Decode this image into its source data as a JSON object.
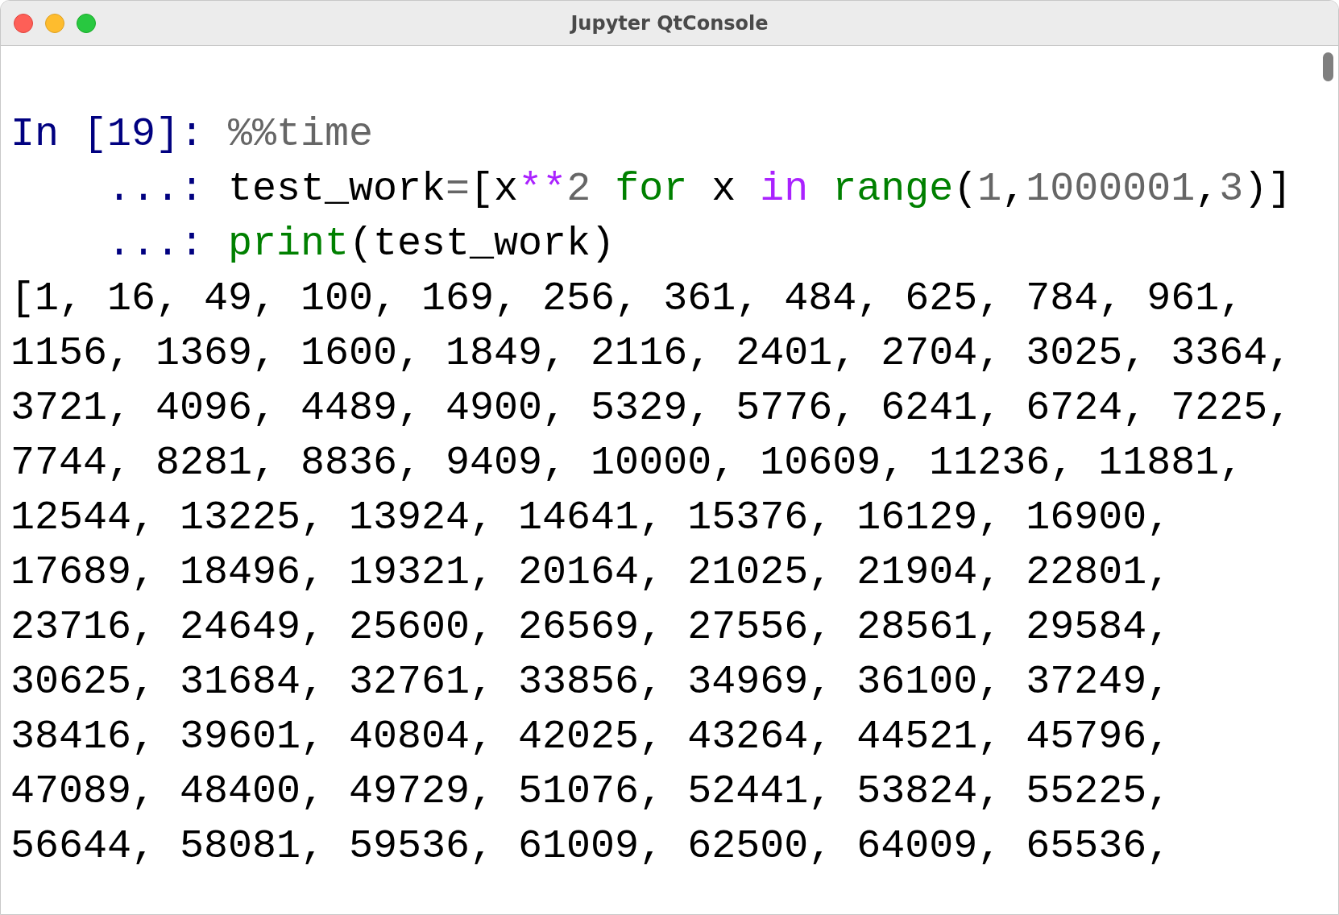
{
  "window": {
    "title": "Jupyter QtConsole"
  },
  "input": {
    "lines": [
      {
        "segments": [
          {
            "kind": "prompt",
            "text": "In [19]: "
          },
          {
            "kind": "magic",
            "text": "%%time"
          }
        ]
      },
      {
        "segments": [
          {
            "kind": "prompt",
            "text": "    ...: "
          },
          {
            "kind": "name",
            "text": "test_work"
          },
          {
            "kind": "operator",
            "text": "="
          },
          {
            "kind": "name",
            "text": "[x"
          },
          {
            "kind": "power",
            "text": "**"
          },
          {
            "kind": "number",
            "text": "2"
          },
          {
            "kind": "keyword",
            "text": " for"
          },
          {
            "kind": "name",
            "text": " x "
          },
          {
            "kind": "in",
            "text": "in"
          },
          {
            "kind": "builtin",
            "text": " range"
          },
          {
            "kind": "name",
            "text": "("
          },
          {
            "kind": "number",
            "text": "1"
          },
          {
            "kind": "name",
            "text": ","
          },
          {
            "kind": "number",
            "text": "1000001"
          },
          {
            "kind": "name",
            "text": ","
          },
          {
            "kind": "number",
            "text": "3"
          },
          {
            "kind": "name",
            "text": ")]"
          }
        ]
      },
      {
        "segments": [
          {
            "kind": "prompt",
            "text": "    ...: "
          },
          {
            "kind": "builtin",
            "text": "print"
          },
          {
            "kind": "name",
            "text": "(test_work)"
          }
        ]
      }
    ]
  },
  "output": {
    "lines": [
      "[1, 16, 49, 100, 169, 256, 361, 484, 625, 784, 961,",
      "1156, 1369, 1600, 1849, 2116, 2401, 2704, 3025, 3364,",
      "3721, 4096, 4489, 4900, 5329, 5776, 6241, 6724, 7225,",
      "7744, 8281, 8836, 9409, 10000, 10609, 11236, 11881,",
      "12544, 13225, 13924, 14641, 15376, 16129, 16900,",
      "17689, 18496, 19321, 20164, 21025, 21904, 22801,",
      "23716, 24649, 25600, 26569, 27556, 28561, 29584,",
      "30625, 31684, 32761, 33856, 34969, 36100, 37249,",
      "38416, 39601, 40804, 42025, 43264, 44521, 45796,",
      "47089, 48400, 49729, 51076, 52441, 53824, 55225,",
      "56644, 58081, 59536, 61009, 62500, 64009, 65536,"
    ]
  }
}
